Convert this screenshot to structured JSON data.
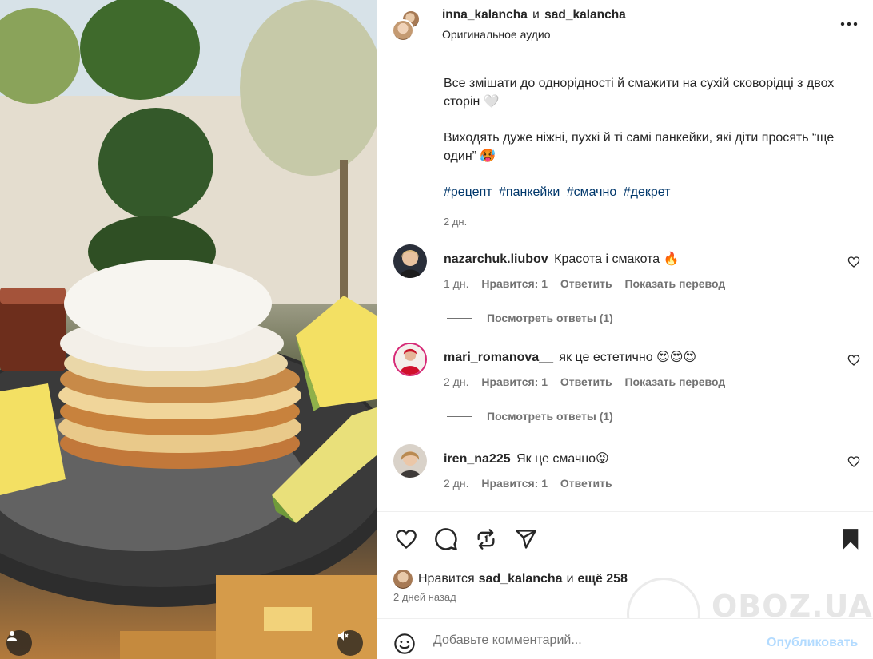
{
  "post": {
    "author1": "inna_kalancha",
    "and": "и",
    "author2": "sad_kalancha",
    "audio": "Оригинальное аудио"
  },
  "caption": {
    "para1": "Все змішати до однорідності й смажити на сухій сковорідці з двох сторін 🤍",
    "para2": "Виходять дуже ніжні, пухкі й ті самі панкейки, які діти просять “ще один” 🥵",
    "tags": [
      "#рецепт",
      "#панкейки",
      "#смачно",
      "#декрет"
    ],
    "time": "2 дн."
  },
  "comments": [
    {
      "user": "nazarchuk.liubov",
      "text": "Красота і смакота 🔥",
      "time": "1 дн.",
      "likes": "Нравится: 1",
      "reply": "Ответить",
      "translate": "Показать перевод",
      "view_replies": "Посмотреть ответы (1)"
    },
    {
      "user": "mari_romanova__",
      "text": "як це естетично 😍😍😍",
      "time": "2 дн.",
      "likes": "Нравится: 1",
      "reply": "Ответить",
      "translate": "Показать перевод",
      "view_replies": "Посмотреть ответы (1)"
    },
    {
      "user": "iren_na225",
      "text": "Як це смачно😝",
      "time": "2 дн.",
      "likes": "Нравится: 1",
      "reply": "Ответить"
    }
  ],
  "likes": {
    "prefix": "Нравится",
    "user": "sad_kalancha",
    "and": "и",
    "more": "ещё 258"
  },
  "post_time": "2 дней назад",
  "watermark": "OBOZ.UA",
  "comment_box": {
    "placeholder": "Добавьте комментарий...",
    "publish": "Опубликовать"
  },
  "icons": [
    "more-icon",
    "heart-icon",
    "comment-icon",
    "share-icon",
    "send-icon",
    "bookmark-icon",
    "emoji-icon",
    "user-tag-icon",
    "mute-icon"
  ]
}
